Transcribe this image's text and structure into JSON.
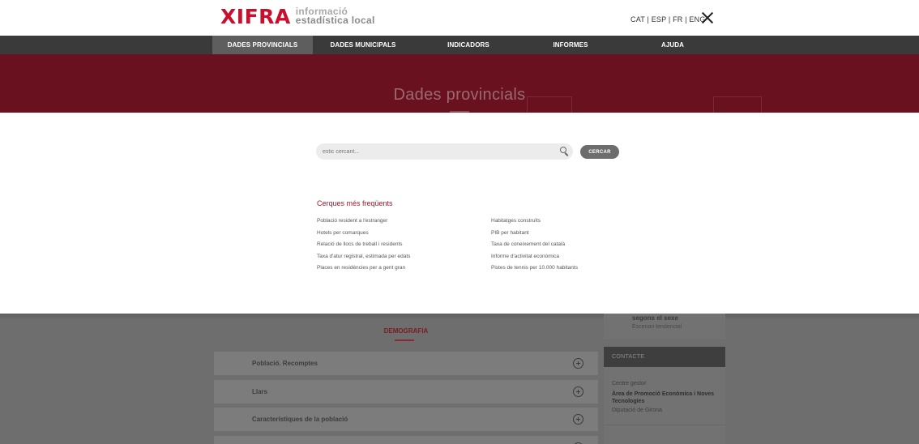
{
  "header": {
    "logo": "XIFRA",
    "logo_line1": "informació",
    "logo_line2": "estadística local",
    "languages": "CAT | ESP | FR | ENG"
  },
  "nav": {
    "items": [
      {
        "label": "DADES PROVINCIALS",
        "active": true
      },
      {
        "label": "DADES MUNICIPALS"
      },
      {
        "label": "INDICADORS"
      },
      {
        "label": "INFORMES"
      },
      {
        "label": "AJUDA"
      }
    ]
  },
  "hero": {
    "title": "Dades provincials"
  },
  "search": {
    "placeholder": "estic cercant...",
    "button_label": "CERCAR"
  },
  "frequent": {
    "title": "Cerques més freqüents",
    "left": [
      "Població resident a l'estranger",
      "Hotels per comarques",
      "Relació de llocs de treball i residents",
      "Taxa d'atur registral, estimada per edats",
      "Places en residències per a gent gran"
    ],
    "right": [
      "Habitatges construïts",
      "PIB per habitant",
      "Taxa de coneixement del català",
      "Informe d'activitat econòmica",
      "Pistes de tennis per 10.000 habitants"
    ]
  },
  "category": {
    "title": "DEMOGRAFIA",
    "rows": [
      "Població. Recomptes",
      "Llars",
      "Característiques de la població"
    ]
  },
  "sidebar": {
    "partial_title": "segons el sexe",
    "partial_sub": "Escenari tendencial",
    "contact_header": "CONTACTE",
    "centre_label": "Centre gestor",
    "centre_name": "Àrea de Promoció Econòmica i Noves Tecnologies",
    "centre_org": "Diputació de Girona"
  },
  "colors": {
    "brand_red": "#c8102e",
    "hero_bg": "#69111e",
    "nav_bg": "#3a3a3a"
  }
}
